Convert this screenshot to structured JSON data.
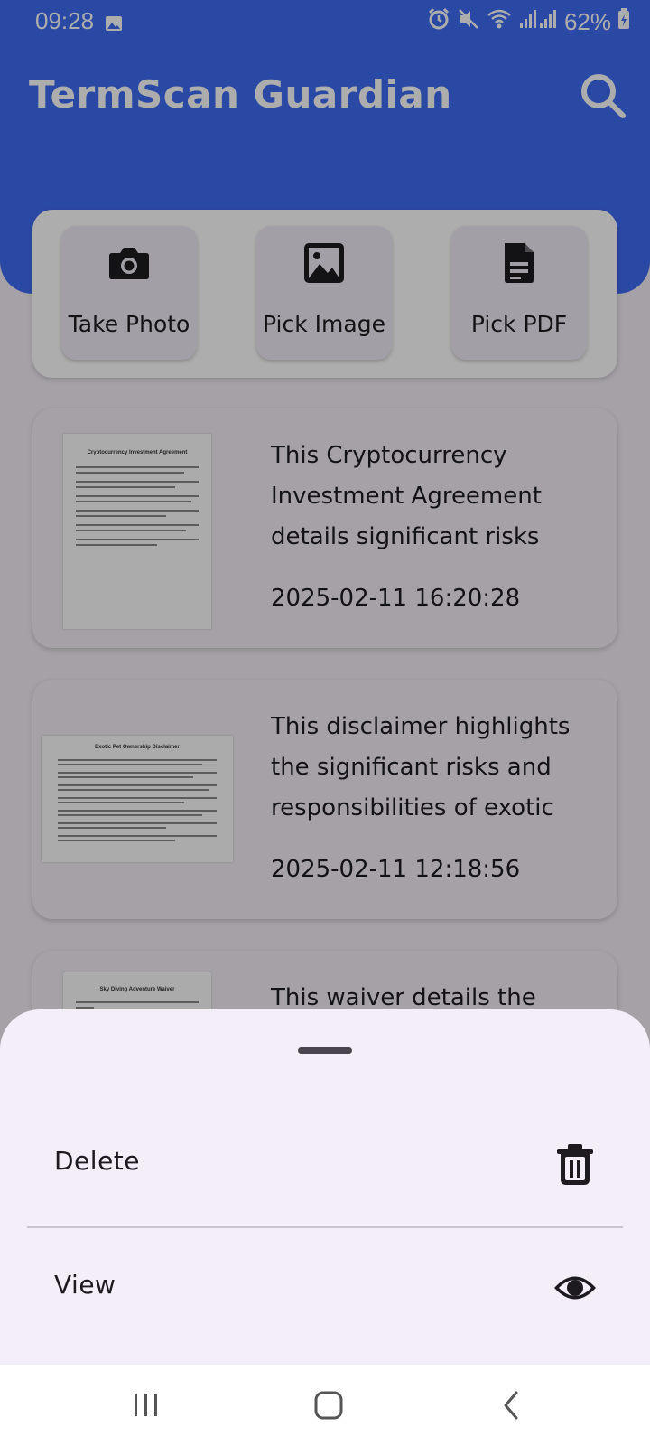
{
  "status_bar": {
    "time": "09:28",
    "battery": "62%"
  },
  "app_bar": {
    "title": "TermScan Guardian"
  },
  "actions": [
    {
      "label": "Take Photo",
      "icon": "camera-icon"
    },
    {
      "label": "Pick Image",
      "icon": "image-icon"
    },
    {
      "label": "Pick PDF",
      "icon": "document-icon"
    }
  ],
  "documents": [
    {
      "thumbnail_title": "Cryptocurrency Investment Agreement",
      "summary": "This Cryptocurrency Investment Agreement details significant risks",
      "date": "2025-02-11 16:20:28"
    },
    {
      "thumbnail_title": "Exotic Pet Ownership Disclaimer",
      "summary": "This disclaimer highlights the significant risks and responsibilities of exotic",
      "date": "2025-02-11 12:18:56"
    },
    {
      "thumbnail_title": "Sky Diving Adventure Waiver",
      "summary": "This waiver details the",
      "date": ""
    }
  ],
  "bottom_sheet": {
    "options": [
      {
        "label": "Delete",
        "icon": "trash-icon"
      },
      {
        "label": "View",
        "icon": "eye-icon"
      }
    ]
  },
  "colors": {
    "primary": "#3f6cf3",
    "surface": "#f3eef8",
    "on_surface": "#1d1b20"
  }
}
